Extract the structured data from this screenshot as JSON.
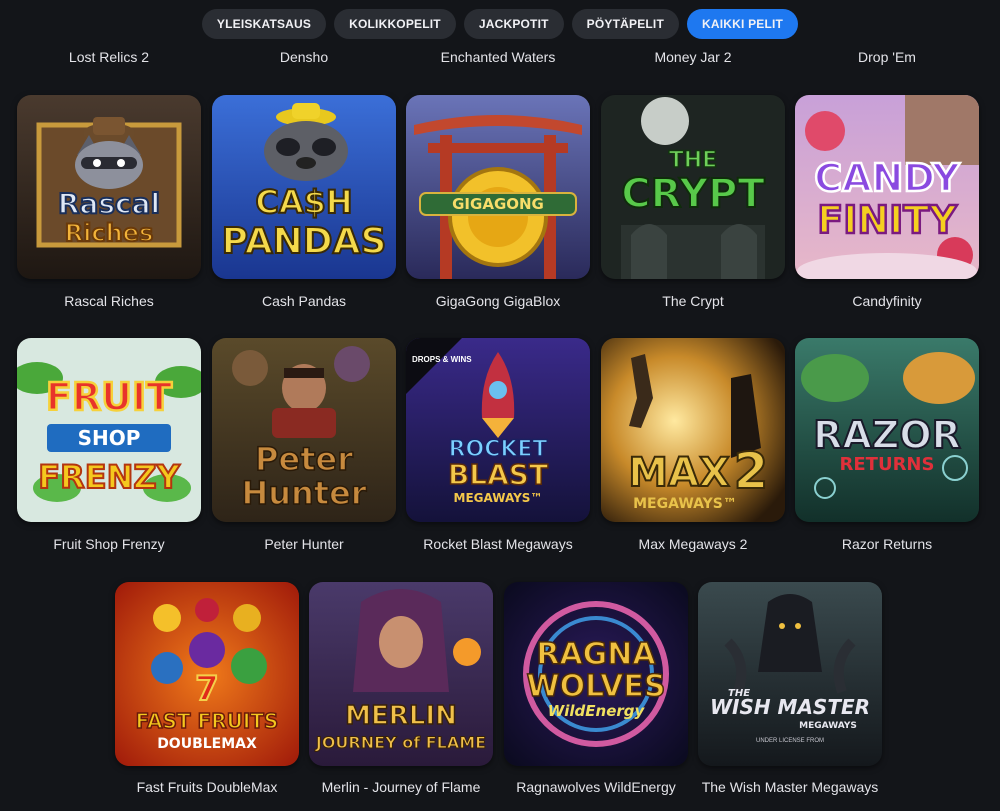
{
  "tabs": [
    {
      "label": "YLEISKATSAUS",
      "active": false
    },
    {
      "label": "KOLIKKOPELIT",
      "active": false
    },
    {
      "label": "JACKPOTIT",
      "active": false
    },
    {
      "label": "PÖYTÄPELIT",
      "active": false
    },
    {
      "label": "KAIKKI PELIT",
      "active": true
    }
  ],
  "top_row_names": [
    "Lost Relics 2",
    "Densho",
    "Enchanted Waters",
    "Money Jar 2",
    "Drop 'Em"
  ],
  "games": [
    {
      "name": "Rascal Riches",
      "art_lines": [
        "Rascal",
        "Riches"
      ]
    },
    {
      "name": "Cash Pandas",
      "art_lines": [
        "CA$H",
        "PANDAS"
      ]
    },
    {
      "name": "GigaGong GigaBlox",
      "art_lines": [
        "GIGAGONG"
      ]
    },
    {
      "name": "The Crypt",
      "art_lines": [
        "THE",
        "CRYPT"
      ]
    },
    {
      "name": "Candyfinity",
      "art_lines": [
        "CANDY",
        "FINITY"
      ]
    },
    {
      "name": "Fruit Shop Frenzy",
      "art_lines": [
        "FRUIT",
        "SHOP",
        "FRENZY"
      ]
    },
    {
      "name": "Peter Hunter",
      "art_lines": [
        "Peter",
        "Hunter"
      ]
    },
    {
      "name": "Rocket Blast Megaways",
      "art_lines": [
        "ROCKET",
        "BLAST",
        "MEGAWAYS™"
      ],
      "badge": "DROPS & WINS"
    },
    {
      "name": "Max Megaways 2",
      "art_lines": [
        "MAX",
        "2",
        "MEGAWAYS™"
      ]
    },
    {
      "name": "Razor Returns",
      "art_lines": [
        "RAZOR",
        "RETURNS"
      ]
    },
    {
      "name": "Fast Fruits DoubleMax",
      "art_lines": [
        "FAST FRUITS",
        "DOUBLEMAX"
      ]
    },
    {
      "name": "Merlin - Journey of Flame",
      "art_lines": [
        "MERLIN",
        "JOURNEY of FLAME"
      ]
    },
    {
      "name": "Ragnawolves WildEnergy",
      "art_lines": [
        "RAGNA",
        "WOLVES",
        "WildEnergy"
      ]
    },
    {
      "name": "The Wish Master Megaways",
      "art_lines": [
        "THE",
        "WISH MASTER",
        "MEGAWAYS",
        "UNDER LICENSE FROM"
      ]
    }
  ],
  "colors": {
    "background": "#131519",
    "tab": "#2a2d33",
    "tab_active": "#1e78f0",
    "text": "#e3e3e8"
  }
}
